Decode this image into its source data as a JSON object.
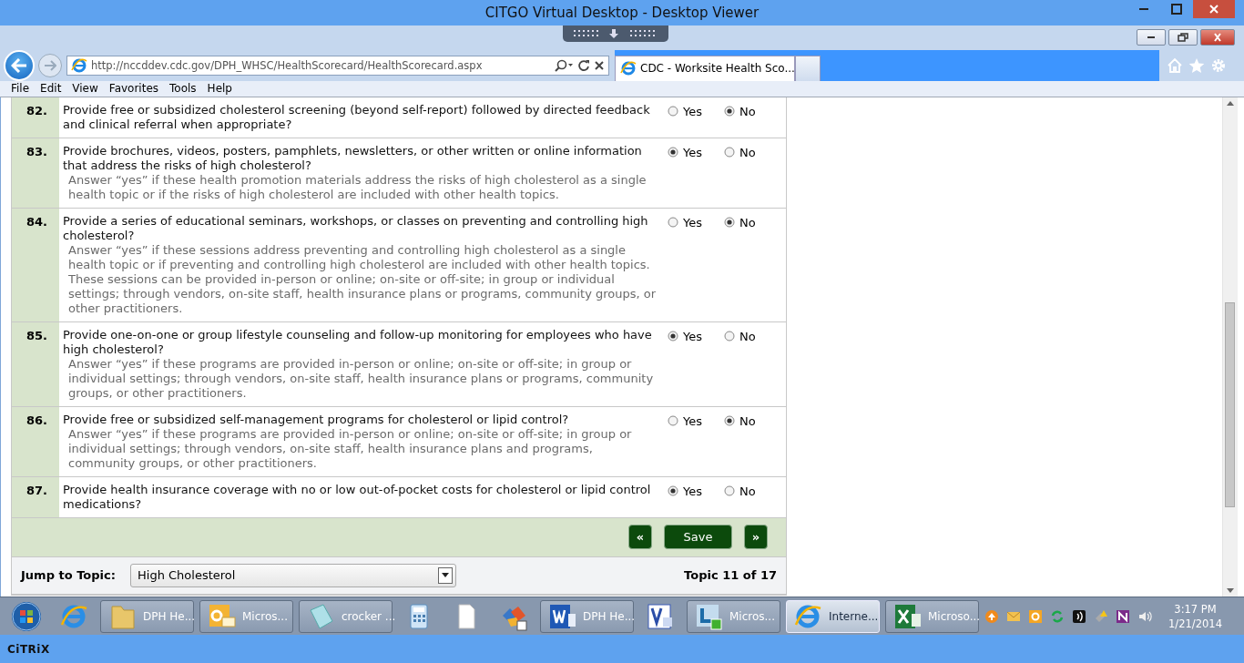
{
  "viewer": {
    "title": "CITGO Virtual Desktop - Desktop Viewer"
  },
  "browser": {
    "address": "http://nccddev.cdc.gov/DPH_WHSC/HealthScorecard/HealthScorecard.aspx",
    "tabs": [
      {
        "title": "CDC - Worksite Health Sco...",
        "selected": true
      }
    ],
    "menu": [
      "File",
      "Edit",
      "View",
      "Favorites",
      "Tools",
      "Help"
    ]
  },
  "questions": [
    {
      "number": "82.",
      "text": "Provide free or subsidized cholesterol screening (beyond self-report) followed by directed feedback and clinical referral when appropriate?",
      "options": [
        {
          "label": "Yes",
          "selected": false
        },
        {
          "label": "No",
          "selected": true
        }
      ]
    },
    {
      "number": "83.",
      "text": "Provide brochures, videos, posters, pamphlets, newsletters, or other written or online information that address the risks of high cholesterol?",
      "hint": "Answer “yes” if these health promotion materials address the risks of high cholesterol as a single health topic or if the risks of high cholesterol are included with other health topics.",
      "options": [
        {
          "label": "Yes",
          "selected": true
        },
        {
          "label": "No",
          "selected": false
        }
      ]
    },
    {
      "number": "84.",
      "text": "Provide a series of educational seminars, workshops, or classes on preventing and controlling high cholesterol?",
      "hint": "Answer “yes” if these sessions address preventing and controlling high cholesterol as a single health topic or if preventing and controlling high cholesterol are included with other health topics. These sessions can be provided in-person or online; on-site or off-site; in group or individual settings; through vendors, on-site staff, health insurance plans or programs, community groups, or other practitioners.",
      "options": [
        {
          "label": "Yes",
          "selected": false
        },
        {
          "label": "No",
          "selected": true
        }
      ]
    },
    {
      "number": "85.",
      "text": "Provide one-on-one or group lifestyle counseling and follow-up monitoring for employees who have high cholesterol?",
      "hint": "Answer “yes” if these programs are provided in-person or online; on-site or off-site; in group or individual settings; through vendors, on-site staff, health insurance plans or programs, community groups, or other practitioners.",
      "options": [
        {
          "label": "Yes",
          "selected": true
        },
        {
          "label": "No",
          "selected": false
        }
      ]
    },
    {
      "number": "86.",
      "text": "Provide free or subsidized self-management programs for cholesterol or lipid control?",
      "hint": "Answer “yes” if these programs are provided in-person or online; on-site or off-site; in group or individual settings; through vendors, on-site staff, health insurance plans and programs, community groups, or other practitioners.",
      "options": [
        {
          "label": "Yes",
          "selected": false
        },
        {
          "label": "No",
          "selected": true
        }
      ]
    },
    {
      "number": "87.",
      "text": "Provide health insurance coverage with no or low out-of-pocket costs for cholesterol or lipid control medications?",
      "options": [
        {
          "label": "Yes",
          "selected": true
        },
        {
          "label": "No",
          "selected": false
        }
      ]
    }
  ],
  "footer": {
    "prev": "«",
    "save": "Save",
    "next": "»",
    "jump_label": "Jump to Topic:",
    "topic": "High Cholesterol",
    "topic_count": "Topic 11 of 17"
  },
  "taskbar": {
    "items": [
      {
        "kind": "start",
        "active": false
      },
      {
        "kind": "browser",
        "active": false
      },
      {
        "kind": "folder",
        "label": "DPH He...",
        "active": false
      },
      {
        "kind": "mail",
        "label": "Micros...",
        "active": false
      },
      {
        "kind": "notepad",
        "label": "crocker ...",
        "active": false
      },
      {
        "kind": "calculator",
        "active": false
      },
      {
        "kind": "document",
        "active": false
      },
      {
        "kind": "puzzle",
        "active": false
      },
      {
        "kind": "word",
        "label": "DPH He...",
        "active": false
      },
      {
        "kind": "visio",
        "active": false
      },
      {
        "kind": "chat",
        "label": "Micros...",
        "active": false
      },
      {
        "kind": "browser",
        "label": "Interne...",
        "active": true
      },
      {
        "kind": "excel",
        "label": "Microso...",
        "active": false
      }
    ],
    "time": "3:17 PM",
    "date": "1/21/2014"
  },
  "citrix_logo": "CiTRiX"
}
